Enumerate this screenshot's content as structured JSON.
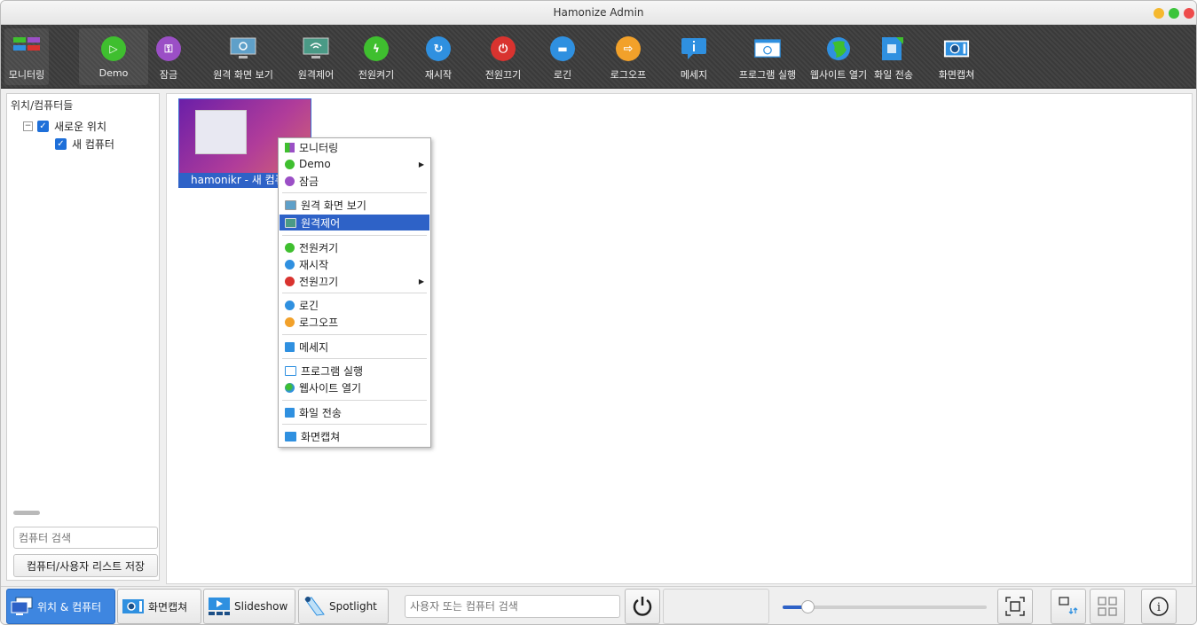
{
  "window": {
    "title": "Hamonize Admin"
  },
  "traffic_lights": {
    "colors": [
      "#f5b82e",
      "#3bc43b",
      "#ee4c4c"
    ]
  },
  "toolbar": {
    "items": [
      {
        "id": "monitoring",
        "label": "모니터링",
        "icon": "monitoring-grid-icon",
        "active": true
      },
      {
        "id": "demo",
        "label": "Demo",
        "icon": "demo-presentation-icon",
        "active": true
      },
      {
        "id": "lock",
        "label": "잠금",
        "icon": "lock-icon"
      },
      {
        "id": "remote-view",
        "label": "원격 화면 보기",
        "icon": "remote-view-monitor-icon"
      },
      {
        "id": "remote-control",
        "label": "원격제어",
        "icon": "remote-control-wifi-icon"
      },
      {
        "id": "power-on",
        "label": "전원켜기",
        "icon": "power-on-icon"
      },
      {
        "id": "restart",
        "label": "재시작",
        "icon": "restart-icon"
      },
      {
        "id": "power-off",
        "label": "전원끄기",
        "icon": "power-off-icon"
      },
      {
        "id": "login",
        "label": "로긴",
        "icon": "login-icon"
      },
      {
        "id": "logoff",
        "label": "로그오프",
        "icon": "logoff-icon"
      },
      {
        "id": "message",
        "label": "메세지",
        "icon": "message-icon"
      },
      {
        "id": "run-program",
        "label": "프로그램 실행",
        "icon": "run-program-window-icon"
      },
      {
        "id": "open-website",
        "label": "웹사이트 열기",
        "icon": "globe-icon"
      },
      {
        "id": "file-transfer",
        "label": "화일 전송",
        "icon": "file-transfer-icon"
      },
      {
        "id": "screenshot",
        "label": "화면캡쳐",
        "icon": "camera-icon"
      }
    ]
  },
  "sidebar": {
    "header": "위치/컴퓨터들",
    "tree": [
      {
        "label": "새로운 위치",
        "checked": true,
        "level": 0,
        "expanded": true
      },
      {
        "label": "새 컴퓨터",
        "checked": true,
        "level": 1
      }
    ],
    "search_placeholder": "컴퓨터 검색",
    "save_label": "컴퓨터/사용자 리스트 저장"
  },
  "main": {
    "computer_tile": {
      "label": "hamonikr - 새 컴퓨터"
    }
  },
  "context_menu": {
    "items": [
      {
        "label": "모니터링",
        "icon": "monitoring-grid-icon"
      },
      {
        "label": "Demo",
        "icon": "demo-presentation-icon",
        "submenu": true
      },
      {
        "label": "잠금",
        "icon": "lock-icon"
      },
      {
        "label": "원격 화면 보기",
        "icon": "remote-view-monitor-icon"
      },
      {
        "label": "원격제어",
        "icon": "remote-control-monitor-icon",
        "highlighted": true
      },
      {
        "label": "전원켜기",
        "icon": "power-on-icon"
      },
      {
        "label": "재시작",
        "icon": "restart-icon"
      },
      {
        "label": "전원끄기",
        "icon": "power-off-icon",
        "submenu": true
      },
      {
        "label": "로긴",
        "icon": "login-icon"
      },
      {
        "label": "로그오프",
        "icon": "logoff-icon"
      },
      {
        "label": "메세지",
        "icon": "message-icon"
      },
      {
        "label": "프로그램 실행",
        "icon": "run-program-window-icon"
      },
      {
        "label": "웹사이트 열기",
        "icon": "globe-icon"
      },
      {
        "label": "화일 전송",
        "icon": "file-transfer-icon"
      },
      {
        "label": "화면캡쳐",
        "icon": "camera-icon"
      }
    ],
    "submenu_arrow": "▶"
  },
  "bottombar": {
    "locations_label": "위치 & 컴퓨터",
    "screenshot_label": "화면캡쳐",
    "slideshow_label": "Slideshow",
    "spotlight_label": "Spotlight",
    "user_search_placeholder": "사용자 또는 컴퓨터 검색",
    "zoom_level": 0.12,
    "info_symbol": "i"
  },
  "colors": {
    "accent": "#2e62c7",
    "selection": "#3e86e0",
    "toolbar_bg": "#3f3f3f",
    "green": "#3fbf2f",
    "purple": "#9b4fc6",
    "blue": "#2f90e0",
    "red": "#d9332f",
    "orange": "#f2a12a"
  }
}
